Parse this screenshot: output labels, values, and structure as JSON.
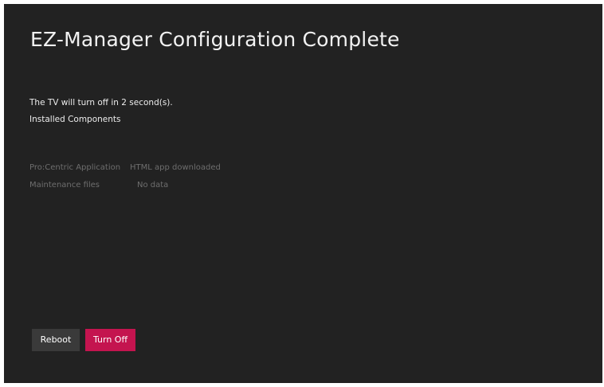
{
  "dialog": {
    "title": "EZ-Manager Configuration Complete",
    "countdown_message": "The TV will turn off in 2 second(s).",
    "installed_heading": "Installed Components"
  },
  "components": [
    {
      "name": "Pro:Centric Application",
      "status": "HTML app downloaded"
    },
    {
      "name": "Maintenance files",
      "status": "No data"
    }
  ],
  "buttons": {
    "reboot_label": "Reboot",
    "turn_off_label": "Turn Off"
  },
  "colors": {
    "background": "#222222",
    "primary_button": "#c4144f",
    "secondary_button": "#3a3a3a"
  }
}
